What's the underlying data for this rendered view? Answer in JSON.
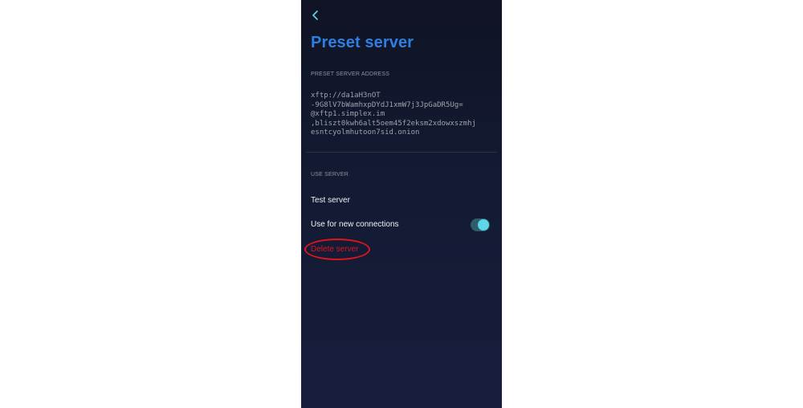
{
  "header": {
    "back_icon": "chevron-left-icon",
    "title": "Preset server"
  },
  "address_section": {
    "label": "PRESET SERVER ADDRESS",
    "lines": [
      "xftp://da1aH3nOT",
      "-9G8lV7bWamhxpDYdJ1xmW7j3JpGaDR5Ug=",
      "@xftp1.simplex.im",
      ",bliszt0kwh6alt5oem45f2eksm2xdowxszmhj",
      "esntcyolmhutoon7sid.onion"
    ]
  },
  "use_section": {
    "label": "USE SERVER",
    "test_server": "Test server",
    "use_for_new_connections": "Use for new connections",
    "toggle_on": true,
    "delete_server": "Delete server"
  },
  "colors": {
    "title": "#2f7fe0",
    "accent": "#5ed6e8",
    "danger": "#e0141a",
    "background": "#131a33"
  }
}
